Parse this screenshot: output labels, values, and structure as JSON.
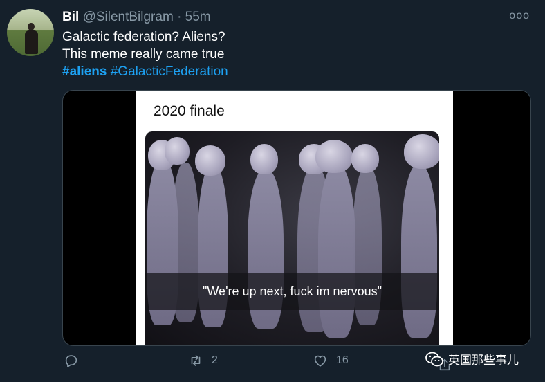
{
  "tweet": {
    "name": "Bil",
    "handle": "@SilentBilgram",
    "separator": "·",
    "time": "55m",
    "more": "ooo",
    "line1": "Galactic federation? Aliens?",
    "line2": "This meme really came true",
    "hashtag1": "#aliens",
    "hashtag2": "#GalacticFederation"
  },
  "meme": {
    "title": "2020 finale",
    "caption": "\"We're up next, fuck im nervous\""
  },
  "actions": {
    "reply_count": "",
    "retweet_count": "2",
    "like_count": "16"
  },
  "watermark": {
    "text": "英国那些事儿"
  },
  "colors": {
    "background": "#15202b",
    "link": "#1da1f2",
    "muted": "#8899a6"
  }
}
